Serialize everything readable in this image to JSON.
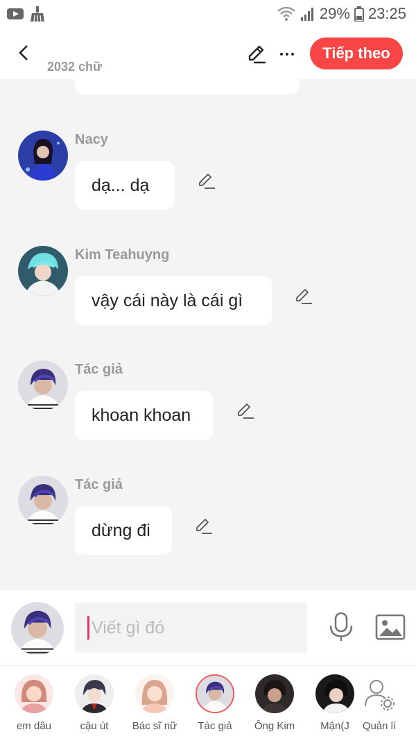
{
  "status_bar": {
    "battery": "29%",
    "time": "23:25",
    "icons": [
      "youtube-icon",
      "broom-icon",
      "wifi-icon",
      "signal-icon",
      "battery-icon"
    ]
  },
  "header": {
    "word_count": "2032 chữ",
    "next_label": "Tiếp theo",
    "icons": [
      "back-icon",
      "pencil-icon",
      "more-icon"
    ]
  },
  "messages": [
    {
      "name": "Nacy",
      "text": "dạ... dạ",
      "avatar": "nacy-avatar"
    },
    {
      "name": "Kim Teahuyng",
      "text": "vậy cái này là cái gì",
      "avatar": "kim-teahuyng-avatar"
    },
    {
      "name": "Tác giả",
      "text": "khoan khoan",
      "avatar": "author-avatar"
    },
    {
      "name": "Tác giả",
      "text": "dừng đi",
      "avatar": "author-avatar"
    }
  ],
  "composer": {
    "placeholder": "Viết gì đó",
    "icons": [
      "microphone-icon",
      "image-icon"
    ]
  },
  "characters": [
    {
      "label": "em dâu"
    },
    {
      "label": "cậu út"
    },
    {
      "label": "Bác sĩ nữ"
    },
    {
      "label": "Tác giả",
      "active": true
    },
    {
      "label": "Ông Kim"
    },
    {
      "label": "Mận(J"
    },
    {
      "label": "Quản lí"
    }
  ],
  "colors": {
    "accent": "#f84545",
    "background": "#f4f4f4",
    "bubble": "#ffffff",
    "name_text": "#999999"
  }
}
